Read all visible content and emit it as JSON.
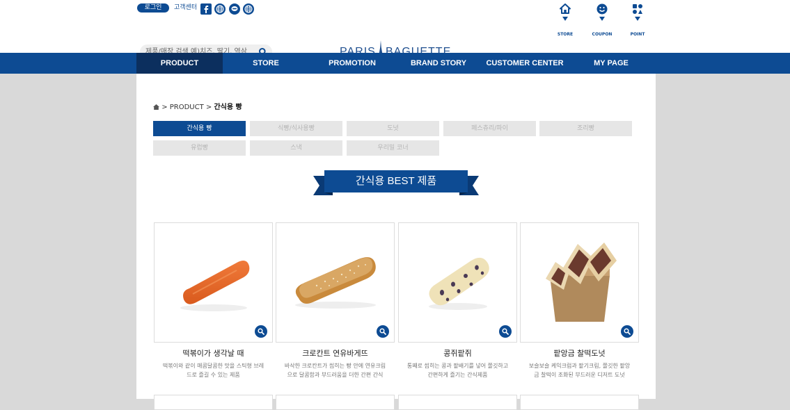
{
  "topbar": {
    "login": "로그인",
    "customer_center": "고객센터",
    "sns": [
      "facebook-icon",
      "globe-icon",
      "talk-icon",
      "globe-icon"
    ]
  },
  "header": {
    "search_placeholder": "제품/매장 검색 예)치즈, 딸기, 역삼",
    "logo_left": "PARIS",
    "logo_right": "BAGUETTE",
    "utils": [
      {
        "label": "STORE",
        "icon": "home-icon"
      },
      {
        "label": "COUPON",
        "icon": "smile-icon"
      },
      {
        "label": "POINT",
        "icon": "point-icon"
      }
    ]
  },
  "nav": {
    "items": [
      "PRODUCT",
      "STORE",
      "PROMOTION",
      "BRAND STORY",
      "CUSTOMER CENTER",
      "MY PAGE"
    ],
    "active_index": 0
  },
  "breadcrumb": {
    "home_icon": "home-icon",
    "level1": "PRODUCT",
    "current": "간식용 빵"
  },
  "categories": {
    "items": [
      "간식용 빵",
      "식빵/식사용빵",
      "도넛",
      "페스츄리/파이",
      "조리빵",
      "유럽빵",
      "스낵",
      "우리밀 코너"
    ],
    "active_index": 0
  },
  "section_title": "간식용 BEST 제품",
  "products": [
    {
      "name": "떡볶이가 생각날 때",
      "desc": "떡볶이와 같이 매콤달콤한 맛을 스틱형 브레드로 즐길 수 있는 제품"
    },
    {
      "name": "크로칸트 연유바게뜨",
      "desc": "바삭한 크로칸트가 씹히는 빵 안에 연유크림으로 달콤함과 부드러움을 더한 간편 간식"
    },
    {
      "name": "콩쥐팥쥐",
      "desc": "통째로 씹히는 콩과 팥배기를 넣어 쫄깃하고 간편하게 즐기는 간식제품"
    },
    {
      "name": "팥앙금 찰떡도넛",
      "desc": "보슬보슬 케익크럼과 팥기크림, 쫄깃한 팥앙금 찰떡이 조화된 부드러운 디저트 도넛"
    }
  ],
  "colors": {
    "brand_blue": "#0d4b93",
    "nav_active": "#0c2f5e",
    "page_bg": "#d9d9d9"
  }
}
